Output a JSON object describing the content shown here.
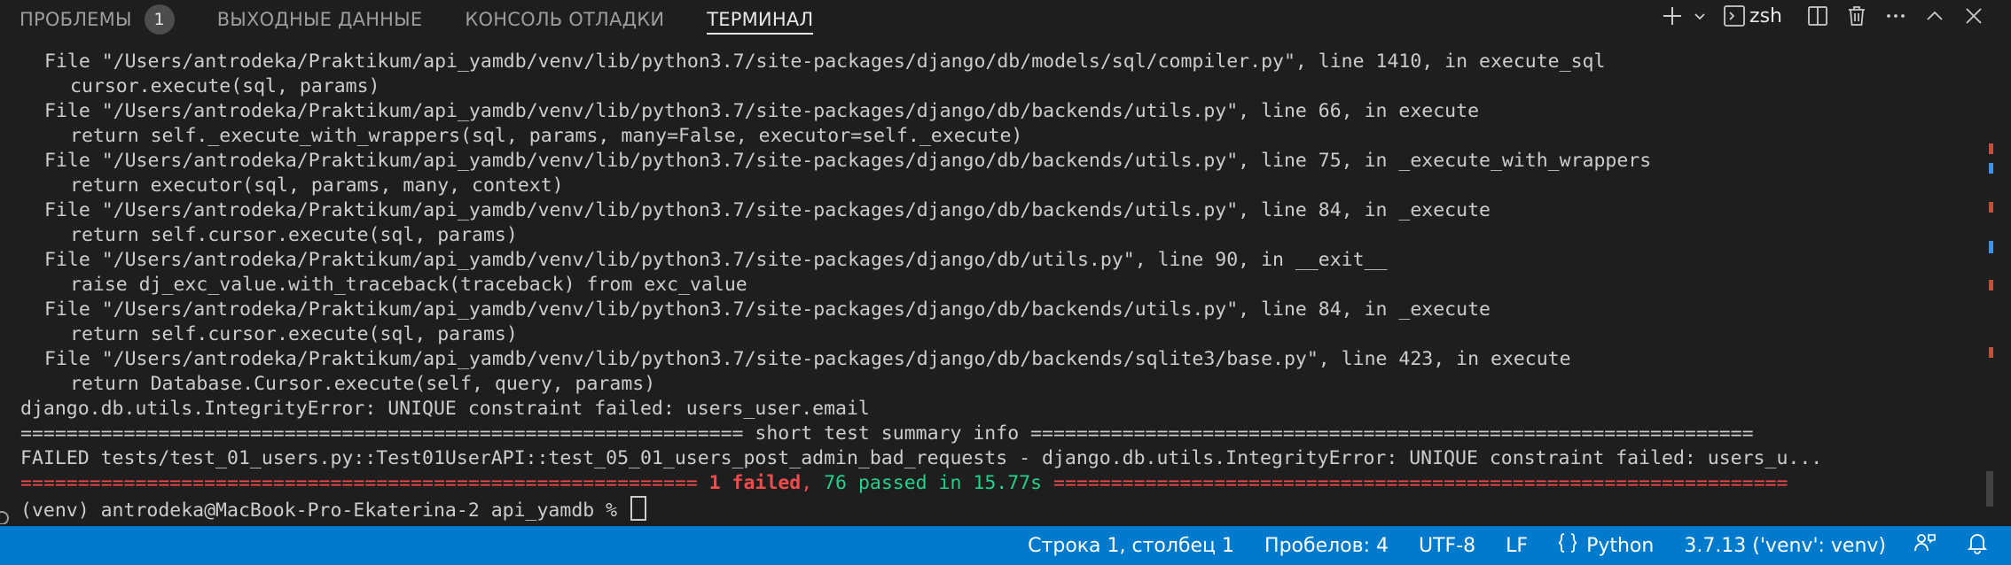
{
  "panel": {
    "tabs": [
      {
        "label": "ПРОБЛЕМЫ",
        "badge": "1"
      },
      {
        "label": "ВЫХОДНЫЕ ДАННЫЕ"
      },
      {
        "label": "КОНСОЛЬ ОТЛАДКИ"
      },
      {
        "label": "ТЕРМИНАЛ"
      }
    ],
    "shell_name": "zsh",
    "icons": [
      "add-icon",
      "chevron-down-icon",
      "terminal-icon",
      "split-icon",
      "trash-icon",
      "more-icon",
      "chevron-up-icon",
      "close-icon"
    ]
  },
  "terminal": {
    "lines": [
      "File \"/Users/antrodeka/Praktikum/api_yamdb/venv/lib/python3.7/site-packages/django/db/models/sql/compiler.py\", line 1410, in execute_sql",
      "cursor.execute(sql, params)",
      "File \"/Users/antrodeka/Praktikum/api_yamdb/venv/lib/python3.7/site-packages/django/db/backends/utils.py\", line 66, in execute",
      "return self._execute_with_wrappers(sql, params, many=False, executor=self._execute)",
      "File \"/Users/antrodeka/Praktikum/api_yamdb/venv/lib/python3.7/site-packages/django/db/backends/utils.py\", line 75, in _execute_with_wrappers",
      "return executor(sql, params, many, context)",
      "File \"/Users/antrodeka/Praktikum/api_yamdb/venv/lib/python3.7/site-packages/django/db/backends/utils.py\", line 84, in _execute",
      "return self.cursor.execute(sql, params)",
      "File \"/Users/antrodeka/Praktikum/api_yamdb/venv/lib/python3.7/site-packages/django/db/utils.py\", line 90, in __exit__",
      "raise dj_exc_value.with_traceback(traceback) from exc_value",
      "File \"/Users/antrodeka/Praktikum/api_yamdb/venv/lib/python3.7/site-packages/django/db/backends/utils.py\", line 84, in _execute",
      "return self.cursor.execute(sql, params)",
      "File \"/Users/antrodeka/Praktikum/api_yamdb/venv/lib/python3.7/site-packages/django/db/backends/sqlite3/base.py\", line 423, in execute",
      "return Database.Cursor.execute(self, query, params)",
      "django.db.utils.IntegrityError: UNIQUE constraint failed: users_user.email",
      "=============================================================== short test summary info ===============================================================",
      "FAILED tests/test_01_users.py::Test01UserAPI::test_05_01_users_post_admin_bad_requests - django.db.utils.IntegrityError: UNIQUE constraint failed: users_u..."
    ],
    "summary": {
      "left_rule": "=========================================================== ",
      "failed": "1 failed",
      "comma": ", ",
      "passed": "76 passed in 15.77s",
      "right_rule": " ================================================================"
    },
    "prompt": "(venv) antrodeka@MacBook-Pro-Ekaterina-2 api_yamdb % ",
    "colors": {
      "background": "#1e1e1e",
      "text": "#cccccc",
      "failed": "#f14c4c",
      "passed": "#23d18b"
    }
  },
  "statusbar": {
    "position": "Строка 1, столбец 1",
    "spaces": "Пробелов: 4",
    "encoding": "UTF-8",
    "eol": "LF",
    "language": "Python",
    "interpreter": "3.7.13 ('venv': venv)",
    "icons": [
      "braces-icon",
      "feedback-icon",
      "bell-icon"
    ],
    "color": "#007acc"
  }
}
